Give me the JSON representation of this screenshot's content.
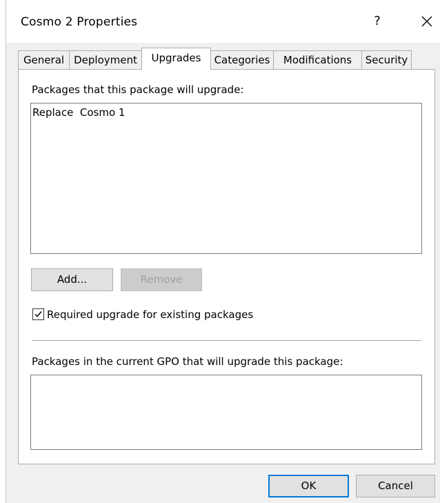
{
  "window": {
    "title": "Cosmo 2 Properties",
    "help_glyph": "?",
    "close_icon": "close-icon"
  },
  "tabs": [
    {
      "label": "General",
      "active": false
    },
    {
      "label": "Deployment",
      "active": false
    },
    {
      "label": "Upgrades",
      "active": true
    },
    {
      "label": "Categories",
      "active": false
    },
    {
      "label": "Modifications",
      "active": false
    },
    {
      "label": "Security",
      "active": false
    }
  ],
  "upgrades": {
    "upgrade_list_label": "Packages that this package will upgrade:",
    "upgrade_list_items": [
      "Replace  Cosmo 1"
    ],
    "add_button": "Add...",
    "remove_button": "Remove",
    "remove_enabled": false,
    "required_upgrade": {
      "label": "Required upgrade for existing packages",
      "checked": true
    },
    "gpo_list_label": "Packages in the current GPO that will upgrade this package:",
    "gpo_list_items": []
  },
  "footer": {
    "ok_button": "OK",
    "cancel_button": "Cancel"
  },
  "colors": {
    "dialog_background": "#f0f0f0",
    "panel_background": "#ffffff",
    "focus_border": "#0078d7"
  }
}
